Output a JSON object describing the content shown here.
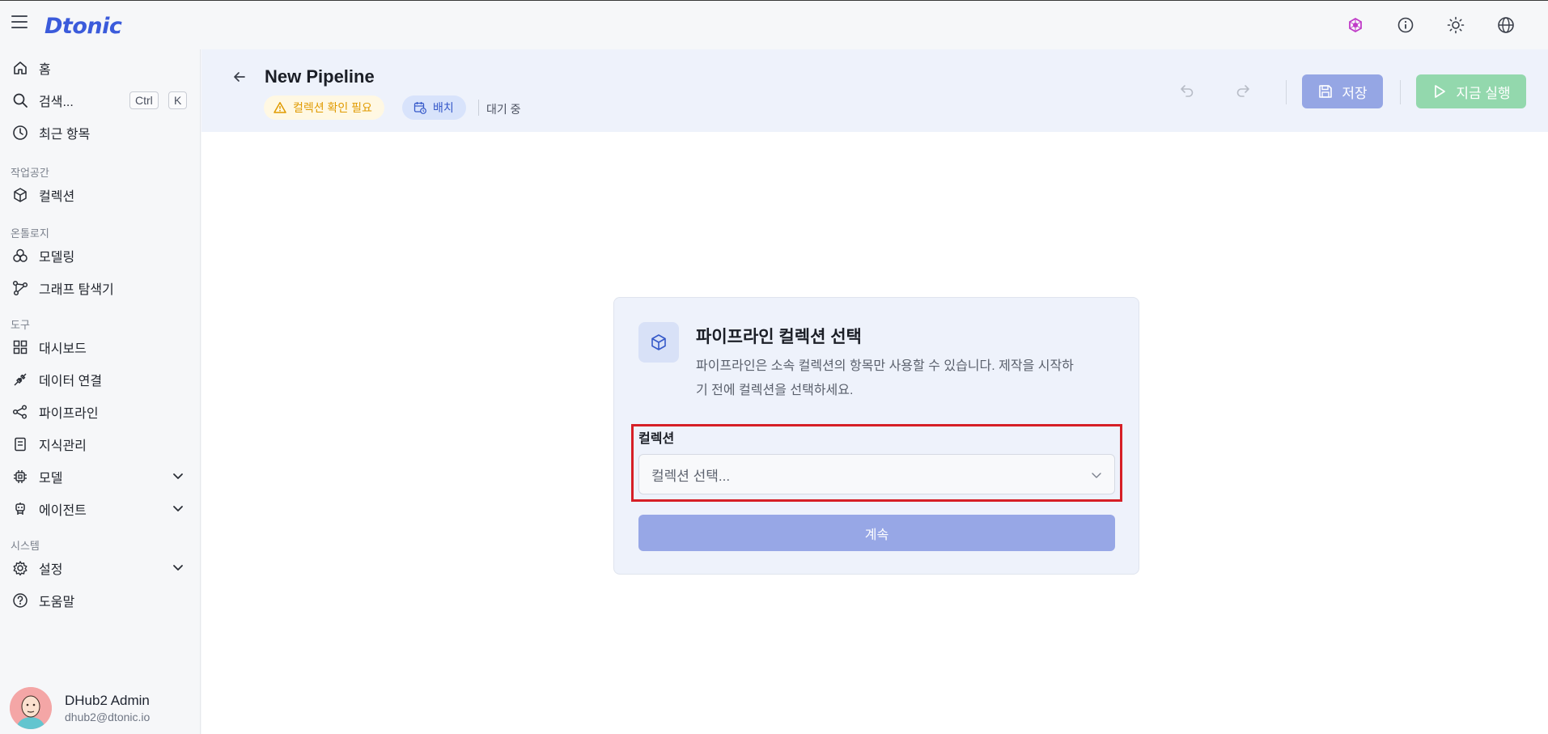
{
  "app": {
    "logo": "Dtonic"
  },
  "sidebar": {
    "home": "홈",
    "search": "검색...",
    "search_kbd_ctrl": "Ctrl",
    "search_kbd_k": "K",
    "recent": "최근 항목",
    "section_workspace": "작업공간",
    "collection": "컬렉션",
    "section_ontology": "온톨로지",
    "modeling": "모델링",
    "graph_explorer": "그래프 탐색기",
    "section_tools": "도구",
    "dashboard": "대시보드",
    "data_connection": "데이터 연결",
    "pipeline": "파이프라인",
    "knowledge": "지식관리",
    "model": "모델",
    "agent": "에이전트",
    "section_system": "시스템",
    "settings": "설정",
    "help": "도움말"
  },
  "user": {
    "name": "DHub2 Admin",
    "email": "dhub2@dtonic.io"
  },
  "header": {
    "title": "New Pipeline",
    "badge_warning": "컬렉션 확인 필요",
    "badge_batch": "배치",
    "status": "대기 중",
    "save_label": "저장",
    "run_label": "지금 실행"
  },
  "dialog": {
    "title": "파이프라인 컬렉션 선택",
    "description": "파이프라인은 소속 컬렉션의 항목만 사용할 수 있습니다. 제작을 시작하기 전에 컬렉션을 선택하세요.",
    "field_label": "컬렉션",
    "select_placeholder": "컬렉션 선택...",
    "continue_label": "계속"
  },
  "colors": {
    "accent": "#3b5bdb",
    "save_button": "#95a6e4",
    "run_button": "#93d8ad",
    "warning": "#e09a00",
    "highlight": "#d61f26"
  }
}
